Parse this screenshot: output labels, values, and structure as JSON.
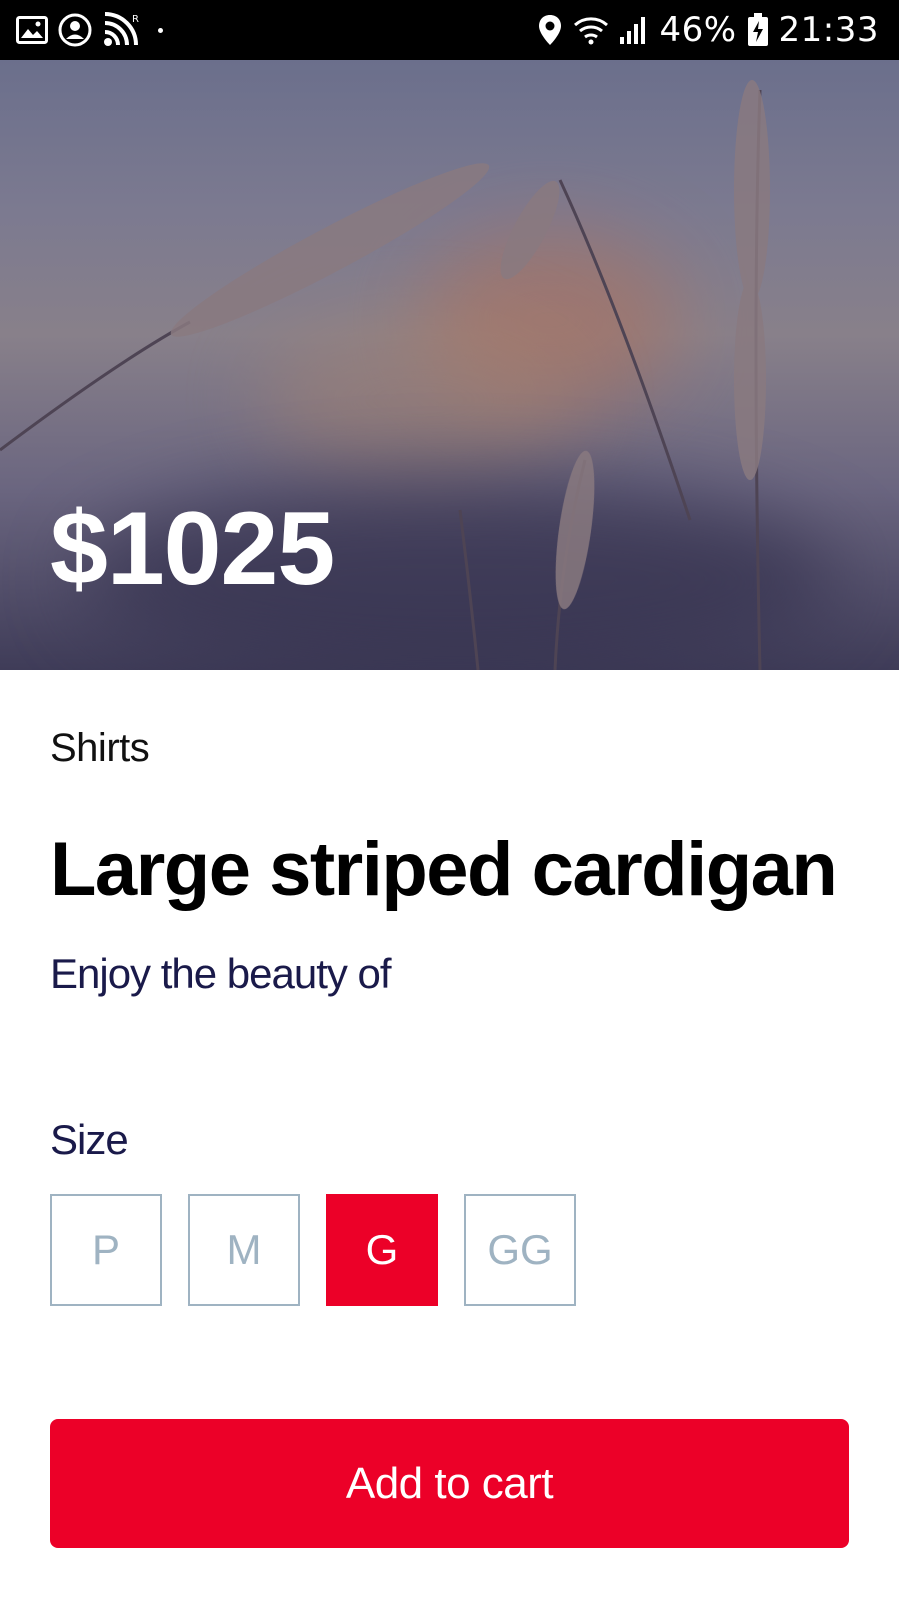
{
  "status_bar": {
    "battery": "46%",
    "time": "21:33",
    "icons": [
      "image-icon",
      "account-icon",
      "cast-icon",
      "location-icon",
      "wifi-icon",
      "signal-icon",
      "battery-charging-icon"
    ]
  },
  "product": {
    "price": "$1025",
    "category": "Shirts",
    "title": "Large striped cardigan",
    "description": "Enjoy the beauty of"
  },
  "size": {
    "label": "Size",
    "options": [
      "P",
      "M",
      "G",
      "GG"
    ],
    "selected": "G"
  },
  "cart": {
    "button_label": "Add to cart"
  },
  "colors": {
    "accent": "#ec0028",
    "text_dark": "#1a1a4a",
    "size_border": "#9fb3c2"
  }
}
